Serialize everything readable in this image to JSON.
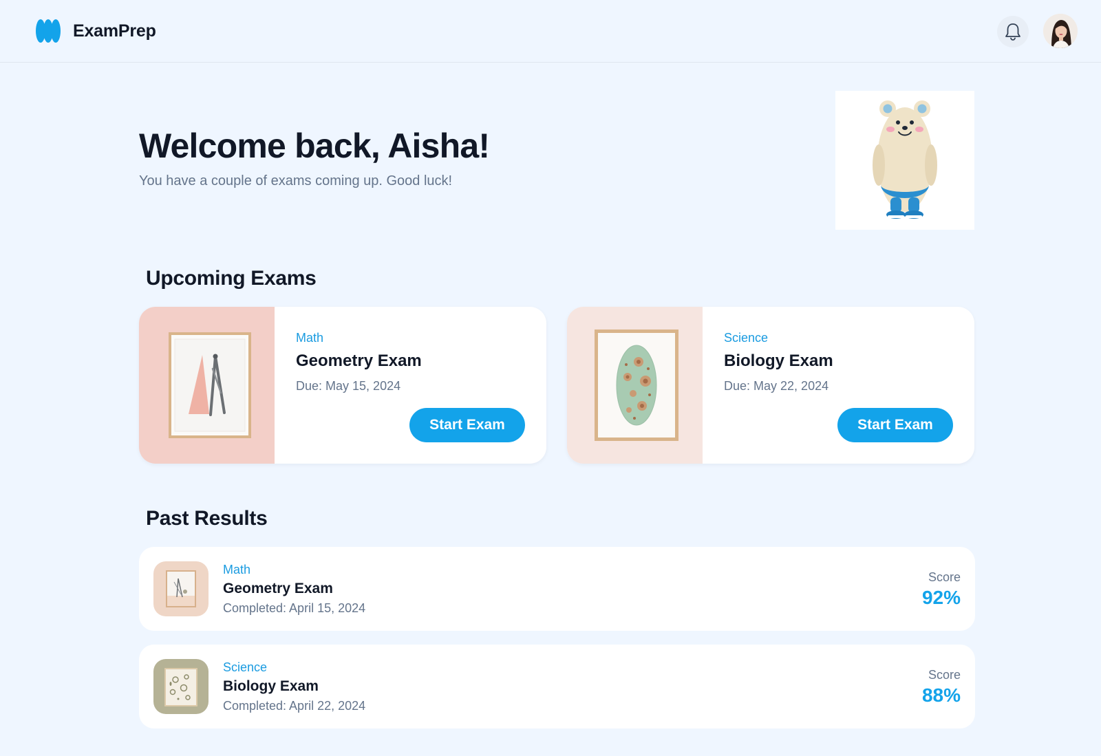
{
  "app": {
    "brand": "ExamPrep",
    "logo_icon": "exam-prep-logo-icon",
    "accent_color": "#13a3ea"
  },
  "header": {
    "notifications_icon": "bell-icon",
    "avatar": "user-avatar"
  },
  "hero": {
    "title": "Welcome back, Aisha!",
    "subtitle": "You have a couple of exams coming up. Good luck!",
    "mascot": "bear-mascot-illustration"
  },
  "upcoming": {
    "title": "Upcoming Exams",
    "exams": [
      {
        "subject": "Math",
        "name": "Geometry Exam",
        "due": "Due: May 15, 2024",
        "button": "Start Exam",
        "art": "geometry-tools-art"
      },
      {
        "subject": "Science",
        "name": "Biology Exam",
        "due": "Due: May 22, 2024",
        "button": "Start Exam",
        "art": "cell-art"
      }
    ]
  },
  "past": {
    "title": "Past Results",
    "results": [
      {
        "subject": "Math",
        "name": "Geometry Exam",
        "completed": "Completed: April 15, 2024",
        "score_label": "Score",
        "score": "92%"
      },
      {
        "subject": "Science",
        "name": "Biology Exam",
        "completed": "Completed: April 22, 2024",
        "score_label": "Score",
        "score": "88%"
      }
    ]
  }
}
